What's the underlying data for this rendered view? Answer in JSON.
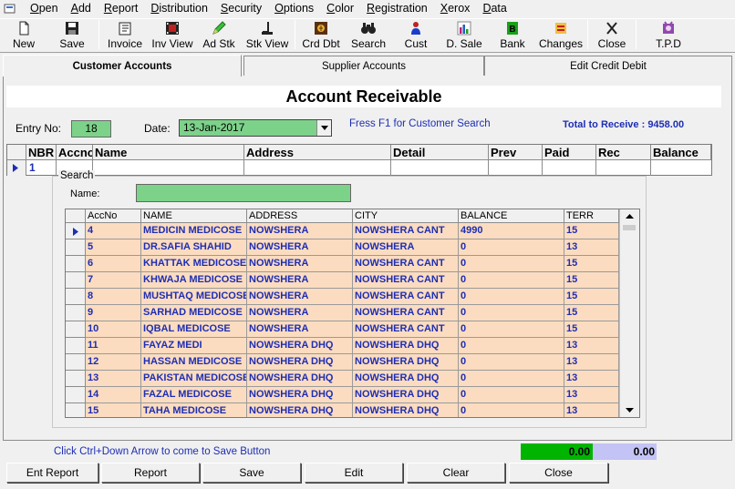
{
  "menu": [
    "Open",
    "Add",
    "Report",
    "Distribution",
    "Security",
    "Options",
    "Color",
    "Registration",
    "Xerox",
    "Data"
  ],
  "toolbar": [
    {
      "label": "New",
      "icon": "new-document-icon"
    },
    {
      "label": "Save",
      "icon": "save-disk-icon"
    },
    {
      "label": "Invoice",
      "icon": "invoice-icon"
    },
    {
      "label": "Inv View",
      "icon": "film-view-icon"
    },
    {
      "label": "Ad Stk",
      "icon": "add-stock-pencil-icon"
    },
    {
      "label": "Stk View",
      "icon": "stock-view-icon"
    },
    {
      "label": "Crd Dbt",
      "icon": "credit-debit-icon"
    },
    {
      "label": "Search",
      "icon": "binoculars-icon"
    },
    {
      "label": "Cust",
      "icon": "customer-icon"
    },
    {
      "label": "D. Sale",
      "icon": "daily-sale-chart-icon"
    },
    {
      "label": "Bank",
      "icon": "bank-icon"
    },
    {
      "label": "Changes",
      "icon": "changes-icon"
    },
    {
      "label": "Close",
      "icon": "close-x-icon"
    },
    {
      "label": "T.P.D",
      "icon": "tpd-icon"
    }
  ],
  "tabs": [
    "Customer Accounts",
    "Supplier Accounts",
    "Edit Credit Debit"
  ],
  "page_title": "Account Receivable",
  "entry": {
    "label": "Entry No:",
    "value": "18"
  },
  "date": {
    "label": "Date:",
    "value": "13-Jan-2017"
  },
  "hint_f1": "Fress F1 for Customer Search",
  "total_receive": "Total to Receive : 9458.00",
  "main_grid": {
    "columns": [
      "NBR",
      "Accno",
      "Name",
      "Address",
      "Detail",
      "Prev",
      "Paid",
      "Rec",
      "Balance"
    ],
    "nbr_value": "1"
  },
  "search": {
    "legend": "Search",
    "name_label": "Name:",
    "columns": [
      "AccNo",
      "NAME",
      "ADDRESS",
      "CITY",
      "BALANCE",
      "TERR"
    ],
    "rows": [
      [
        "4",
        "MEDICIN MEDICOSE",
        "NOWSHERA",
        "NOWSHERA CANT",
        "4990",
        "15"
      ],
      [
        "5",
        "DR.SAFIA  SHAHID",
        "NOWSHERA",
        "NOWSHERA",
        "0",
        "13"
      ],
      [
        "6",
        "KHATTAK MEDICOSE",
        "NOWSHERA",
        "NOWSHERA CANT",
        "0",
        "15"
      ],
      [
        "7",
        "KHWAJA MEDICOSE",
        "NOWSHERA",
        "NOWSHERA CANT",
        "0",
        "15"
      ],
      [
        "8",
        "MUSHTAQ MEDICOSE",
        "NOWSHERA",
        "NOWSHERA CANT",
        "0",
        "15"
      ],
      [
        "9",
        "SARHAD MEDICOSE",
        "NOWSHERA",
        "NOWSHERA CANT",
        "0",
        "15"
      ],
      [
        "10",
        "IQBAL MEDICOSE",
        "NOWSHERA",
        "NOWSHERA CANT",
        "0",
        "15"
      ],
      [
        "11",
        "FAYAZ MEDI",
        "NOWSHERA DHQ",
        "NOWSHERA DHQ",
        "0",
        "13"
      ],
      [
        "12",
        "HASSAN MEDICOSE",
        "NOWSHERA DHQ",
        "NOWSHERA DHQ",
        "0",
        "13"
      ],
      [
        "13",
        "PAKISTAN MEDICOSE",
        "NOWSHERA DHQ",
        "NOWSHERA DHQ",
        "0",
        "13"
      ],
      [
        "14",
        "FAZAL  MEDICOSE",
        "NOWSHERA DHQ",
        "NOWSHERA DHQ",
        "0",
        "13"
      ],
      [
        "15",
        "TAHA  MEDICOSE",
        "NOWSHERA DHQ",
        "NOWSHERA DHQ",
        "0",
        "13"
      ]
    ]
  },
  "save_hint": "Click Ctrl+Down Arrow to come to Save Button",
  "totals": [
    "0.00",
    "0.00"
  ],
  "buttons": [
    "Ent Report",
    "Report",
    "Save",
    "Edit",
    "Clear",
    "Close"
  ]
}
